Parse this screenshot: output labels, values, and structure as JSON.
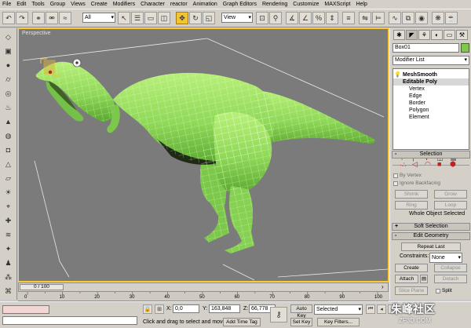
{
  "menu": [
    "File",
    "Edit",
    "Tools",
    "Group",
    "Views",
    "Create",
    "Modifiers",
    "Character",
    "reactor",
    "Animation",
    "Graph Editors",
    "Rendering",
    "Customize",
    "MAXScript",
    "Help"
  ],
  "toolbar": {
    "selection_filter": "All",
    "reference_coord": "View"
  },
  "viewport": {
    "label": "Perspective"
  },
  "command_panel": {
    "object_name": "Box01",
    "object_color": "#7ec94c",
    "modifier_list": "Modifier List",
    "stack": {
      "meshsmooth": "MeshSmooth",
      "editable_poly": "Editable Poly",
      "sub_levels": [
        "Vertex",
        "Edge",
        "Border",
        "Polygon",
        "Element"
      ]
    },
    "selection": {
      "title": "Selection",
      "by_vertex": "By Vertex",
      "ignore_backfacing": "Ignore Backfacing",
      "shrink": "Shrink",
      "grow": "Grow",
      "ring": "Ring",
      "loop": "Loop",
      "status": "Whole Object Selected"
    },
    "soft_selection": {
      "title": "Soft Selection"
    },
    "edit_geometry": {
      "title": "Edit Geometry",
      "repeat_last": "Repeat Last",
      "constraints_label": "Constraints:",
      "constraints_value": "None",
      "create": "Create",
      "collapse": "Collapse",
      "attach": "Attach",
      "detach": "Detach",
      "slice_plane": "Slice Plane",
      "split": "Split"
    }
  },
  "timeline": {
    "frame_display": "0 / 100",
    "ruler_ticks": [
      "0",
      "10",
      "20",
      "30",
      "40",
      "50",
      "60",
      "70",
      "80",
      "90",
      "100"
    ]
  },
  "status": {
    "x_label": "X:",
    "x_value": "0,0",
    "y_label": "Y:",
    "y_value": "163,848",
    "z_label": "Z:",
    "z_value": "66,778",
    "prompt": "Click and drag to select and move",
    "add_time_tag": "Add Time Tag",
    "auto_key": "Auto Key",
    "key_mode": "Selected",
    "set_key": "Set Key",
    "key_filters": "Key Filters..."
  },
  "watermark": {
    "line1": "朱峰社区",
    "line2": "ZF3D.COM"
  }
}
